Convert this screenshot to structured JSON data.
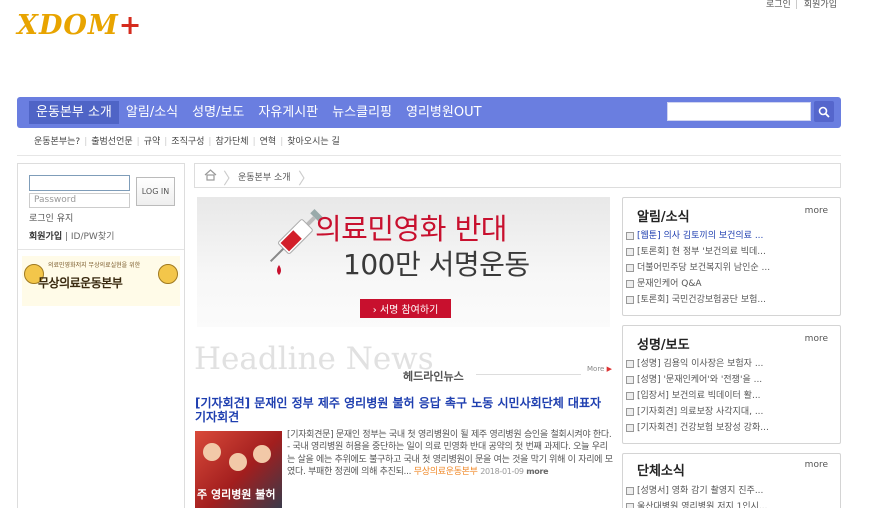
{
  "header": {
    "logo_text": "XDOM",
    "logo_plus": "+",
    "login_link": "로그인",
    "signup_link": "회원가입"
  },
  "nav": {
    "menu": [
      "운동본부 소개",
      "알림/소식",
      "성명/보도",
      "자유게시판",
      "뉴스클리핑",
      "영리병원OUT"
    ],
    "search_placeholder": ""
  },
  "subnav": {
    "items": [
      "운동본부는?",
      "출범선언문",
      "규약",
      "조직구성",
      "참가단체",
      "연혁",
      "찾아오시는 길"
    ]
  },
  "login": {
    "id_value": "",
    "password_placeholder": "Password",
    "button": "LOG IN",
    "remember": "로그인 유지",
    "join": "회원가입",
    "find": "ID/PW찾기"
  },
  "banner": {
    "sub": "의료민영화저지 무상의료실현을 위한",
    "main": "무상의료운동본부"
  },
  "breadcrumb": {
    "current": "운동본부 소개"
  },
  "hero": {
    "line1": "의료민영화 반대",
    "line2": "100만 서명운동",
    "button": "› 서명 참여하기"
  },
  "headline": {
    "bg": "Headline News",
    "label": "헤드라인뉴스",
    "more": "More"
  },
  "article": {
    "title": "[기자회견] 문재인 정부 제주 영리병원 불허 응답 촉구 노동 시민사회단체 대표자 기자회견",
    "body": "[기자회견문] 문재인 정부는 국내 첫 영리병원이 될 제주 영리병원 승인을 철회시켜야 한다. - 국내 영리병원 허용을 중단하는 일이 의료 민영화 반대 공약의 첫 번째 과제다. 오늘 우리는 살을 에는 추위에도 불구하고 국내 첫 영리병원이 문을 여는 것을 막기 위해 이 자리에 모였다. 부패한 정권에 의해 추진되...",
    "source": "무상의료운동본부",
    "date": "2018-01-09",
    "more": "more",
    "thumb_text": "주 영리병원 불허"
  },
  "boxes": [
    {
      "title": "알림/소식",
      "more": "more",
      "items": [
        "[웹툰] 의사 김토끼의 보건의료 ...",
        "[토론회] 현 정부 '보건의료 빅데...",
        "더불어민주당 보건복지위 남인순 ...",
        "문재인케어 Q&A",
        "[토론회] 국민건강보험공단 보험..."
      ]
    },
    {
      "title": "성명/보도",
      "more": "more",
      "items": [
        "[성명] 김용익 이사장은 보험자 ...",
        "[성명] '문재인케어'와 '전쟁'을 ...",
        "[입장서] 보건의료 빅데이터 활...",
        "[기자회견] 의료보장 사각지대, ...",
        "[기자회견] 건강보험 보장성 강화..."
      ]
    },
    {
      "title": "단체소식",
      "more": "more",
      "items": [
        "[성명서] 영화 감기 촬영지 진주...",
        "울산대병원 영리병원 저지 1인시..."
      ]
    }
  ]
}
